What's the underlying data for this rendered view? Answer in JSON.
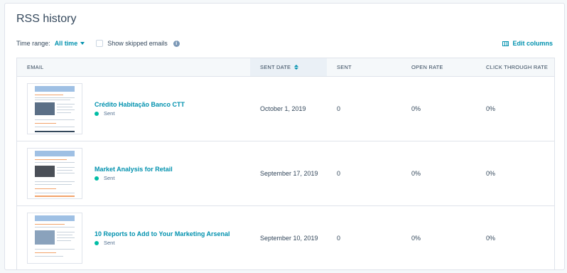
{
  "page": {
    "title": "RSS history"
  },
  "filters": {
    "time_range_label": "Time range:",
    "time_range_value": "All time",
    "show_skipped_label": "Show skipped emails",
    "show_skipped_checked": false,
    "edit_columns_label": "Edit columns"
  },
  "table": {
    "headers": {
      "email": "EMAIL",
      "sent_date": "SENT DATE",
      "sent": "SENT",
      "open_rate": "OPEN RATE",
      "ctr": "CLICK THROUGH RATE"
    },
    "rows": [
      {
        "name": "Crédito Habitação Banco CTT",
        "status": "Sent",
        "sent_date": "October 1, 2019",
        "sent": "0",
        "open_rate": "0%",
        "ctr": "0%"
      },
      {
        "name": "Market Analysis for Retail",
        "status": "Sent",
        "sent_date": "September 17, 2019",
        "sent": "0",
        "open_rate": "0%",
        "ctr": "0%"
      },
      {
        "name": "10 Reports to Add to Your Marketing Arsenal",
        "status": "Sent",
        "sent_date": "September 10, 2019",
        "sent": "0",
        "open_rate": "0%",
        "ctr": "0%"
      }
    ]
  },
  "colors": {
    "accent": "#0091ae",
    "status_sent": "#00bda5",
    "text": "#33475b"
  },
  "icons": {
    "time_range_caret": "chevron-down-icon",
    "info": "info-icon",
    "edit_columns": "columns-icon",
    "sort": "sort-icon"
  }
}
